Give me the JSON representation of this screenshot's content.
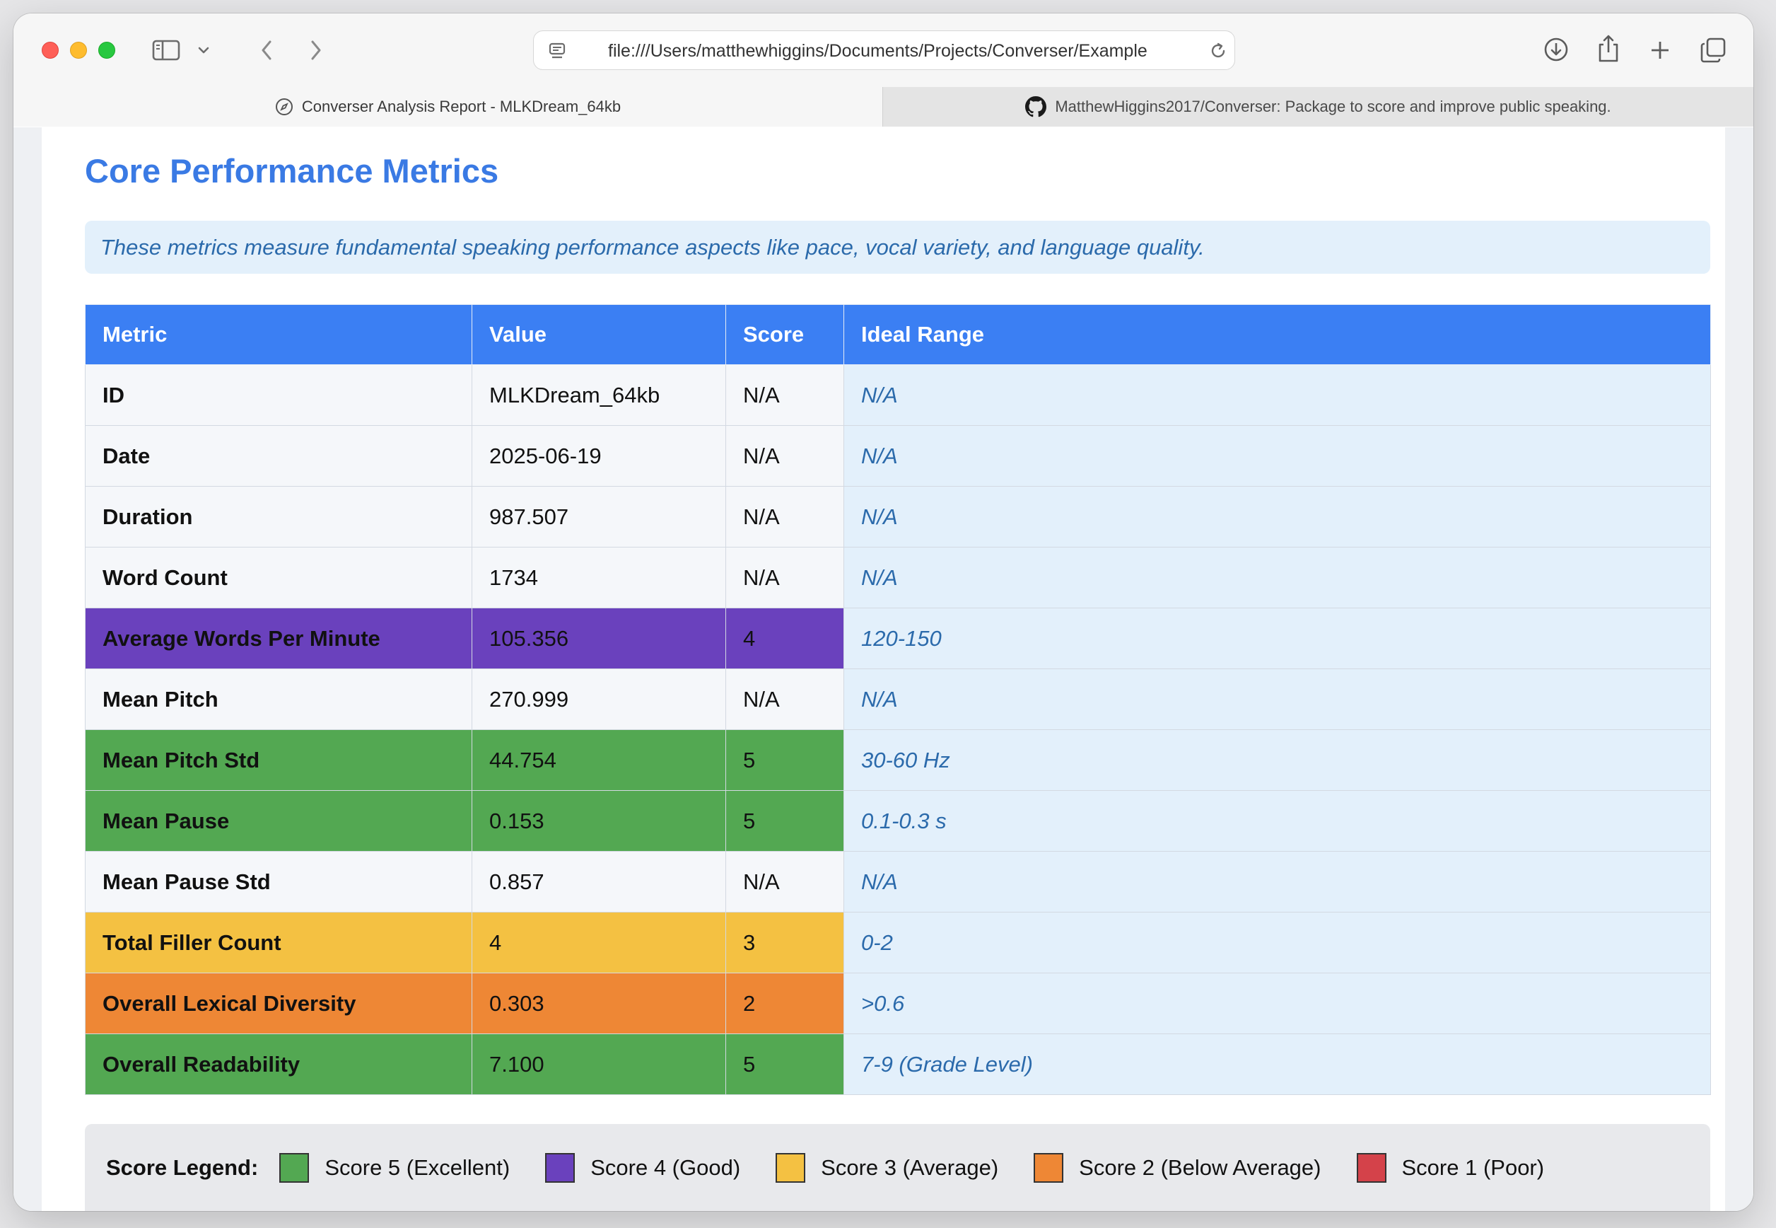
{
  "browser": {
    "url": "file:///Users/matthewhiggins/Documents/Projects/Converser/Example",
    "tabs": [
      {
        "label": "Converser Analysis Report - MLKDream_64kb",
        "icon": "compass-icon",
        "active": true
      },
      {
        "label": "MatthewHiggins2017/Converser: Package to score and improve public speaking.",
        "icon": "github-icon",
        "active": false
      }
    ]
  },
  "page": {
    "heading": "Core Performance Metrics",
    "description": "These metrics measure fundamental speaking performance aspects like pace, vocal variety, and language quality.",
    "table": {
      "headers": [
        "Metric",
        "Value",
        "Score",
        "Ideal Range"
      ],
      "rows": [
        {
          "metric": "ID",
          "value": "MLKDream_64kb",
          "score": "N/A",
          "ideal": "N/A",
          "color": ""
        },
        {
          "metric": "Date",
          "value": "2025-06-19",
          "score": "N/A",
          "ideal": "N/A",
          "color": ""
        },
        {
          "metric": "Duration",
          "value": "987.507",
          "score": "N/A",
          "ideal": "N/A",
          "color": ""
        },
        {
          "metric": "Word Count",
          "value": "1734",
          "score": "N/A",
          "ideal": "N/A",
          "color": ""
        },
        {
          "metric": "Average Words Per Minute",
          "value": "105.356",
          "score": "4",
          "ideal": "120-150",
          "color": "#6a41bd"
        },
        {
          "metric": "Mean Pitch",
          "value": "270.999",
          "score": "N/A",
          "ideal": "N/A",
          "color": ""
        },
        {
          "metric": "Mean Pitch Std",
          "value": "44.754",
          "score": "5",
          "ideal": "30-60 Hz",
          "color": "#53a852"
        },
        {
          "metric": "Mean Pause",
          "value": "0.153",
          "score": "5",
          "ideal": "0.1-0.3 s",
          "color": "#53a852"
        },
        {
          "metric": "Mean Pause Std",
          "value": "0.857",
          "score": "N/A",
          "ideal": "N/A",
          "color": ""
        },
        {
          "metric": "Total Filler Count",
          "value": "4",
          "score": "3",
          "ideal": "0-2",
          "color": "#f4c142"
        },
        {
          "metric": "Overall Lexical Diversity",
          "value": "0.303",
          "score": "2",
          "ideal": ">0.6",
          "color": "#ee8735"
        },
        {
          "metric": "Overall Readability",
          "value": "7.100",
          "score": "5",
          "ideal": "7-9 (Grade Level)",
          "color": "#53a852"
        }
      ]
    },
    "legend": {
      "title": "Score Legend:",
      "items": [
        {
          "label": "Score 5 (Excellent)",
          "color": "#53a852"
        },
        {
          "label": "Score 4 (Good)",
          "color": "#6a41bd"
        },
        {
          "label": "Score 3 (Average)",
          "color": "#f4c142"
        },
        {
          "label": "Score 2 (Below Average)",
          "color": "#ee8735"
        },
        {
          "label": "Score 1 (Poor)",
          "color": "#d4424a"
        }
      ]
    }
  }
}
